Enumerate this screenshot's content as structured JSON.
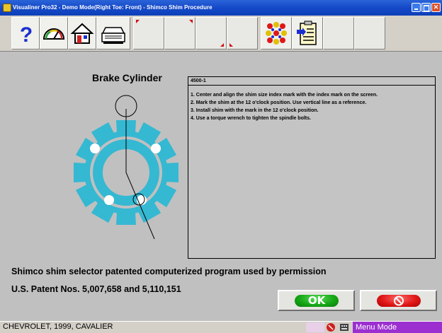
{
  "window": {
    "title": "Visualiner Pro32 - Demo Mode(Right Toe: Front) - Shimco Shim Procedure",
    "close_glyph": "✕"
  },
  "toolbar": {
    "buttons": [
      {
        "name": "help",
        "icon": "question-mark-icon",
        "color": "#1a2fd0"
      },
      {
        "name": "gauge",
        "icon": "speedometer-icon"
      },
      {
        "name": "home",
        "icon": "home-icon"
      },
      {
        "name": "print",
        "icon": "printer-icon"
      },
      {
        "name": "blank1",
        "icon": ""
      },
      {
        "name": "blank2",
        "icon": ""
      },
      {
        "name": "blank3",
        "icon": ""
      },
      {
        "name": "blank4",
        "icon": ""
      },
      {
        "name": "pattern",
        "icon": "dot-pattern-icon"
      },
      {
        "name": "clipboard",
        "icon": "clipboard-arrow-icon"
      },
      {
        "name": "blank5",
        "icon": ""
      },
      {
        "name": "blank6",
        "icon": ""
      }
    ]
  },
  "main": {
    "diagram_title": "Brake Cylinder",
    "panel_header": "4500-1",
    "instructions": [
      "1. Center and align the shim size index mark with the index mark on the screen.",
      "2. Mark the shim at the 12 o'clock position.  Use vertical line as a reference.",
      "3. Install shim with the mark in the 12 o'clock position.",
      "4. Use a torque wrench to tighten the spindle bolts."
    ],
    "permission_text": "Shimco shim selector patented computerized program used by permission",
    "patent_text": "U.S. Patent Nos. 5,007,658 and 5,110,151",
    "ok_label": "OK",
    "cancel_icon": "no-entry-icon"
  },
  "status": {
    "vehicle": "CHEVROLET, 1999, CAVALIER",
    "mode": "Menu Mode"
  },
  "colors": {
    "shim_teal": "#35b8d2",
    "ok_green": "#16a816",
    "cancel_red": "#e01818",
    "status_purple": "#9b2fd0",
    "title_blue": "#1549c9"
  }
}
